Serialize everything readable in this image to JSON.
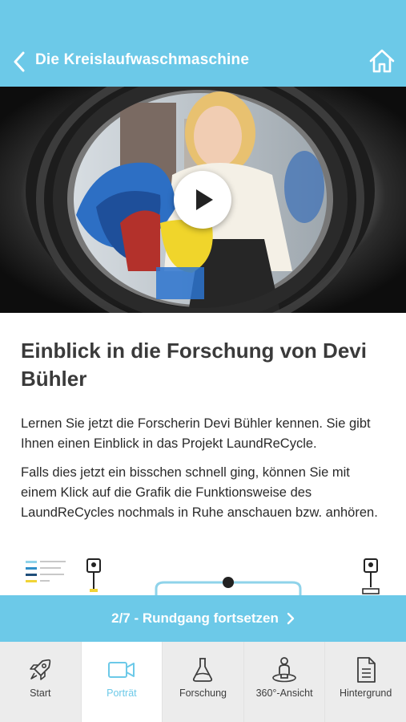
{
  "header": {
    "title": "Die Kreislaufwaschmaschine",
    "back_icon": "chevron-left-icon",
    "home_icon": "home-icon"
  },
  "video": {
    "play_icon": "play-icon"
  },
  "main": {
    "title": "Einblick in die Forschung von Devi Bühler",
    "paragraphs": [
      "Lernen Sie jetzt die Forscherin Devi Bühler kennen. Sie gibt Ihnen einen Einblick in das Projekt LaundReCycle.",
      "Falls dies jetzt ein bisschen schnell ging, können Sie mit einem Klick auf die Grafik die Funktionsweise des LaundReCycles nochmals in Ruhe anschauen bzw. anhören."
    ]
  },
  "cta": {
    "label": "2/7 - Rundgang fortsetzen",
    "icon": "chevron-right-icon"
  },
  "tabs": [
    {
      "label": "Start",
      "icon": "rocket-icon",
      "active": false
    },
    {
      "label": "Porträt",
      "icon": "video-camera-icon",
      "active": true
    },
    {
      "label": "Forschung",
      "icon": "flask-icon",
      "active": false
    },
    {
      "label": "360°-Ansicht",
      "icon": "person-360-icon",
      "active": false
    },
    {
      "label": "Hintergrund",
      "icon": "document-icon",
      "active": false
    }
  ],
  "colors": {
    "accent": "#6cc9e8",
    "tabbar_bg": "#ececec",
    "text": "#2e2e2e"
  }
}
